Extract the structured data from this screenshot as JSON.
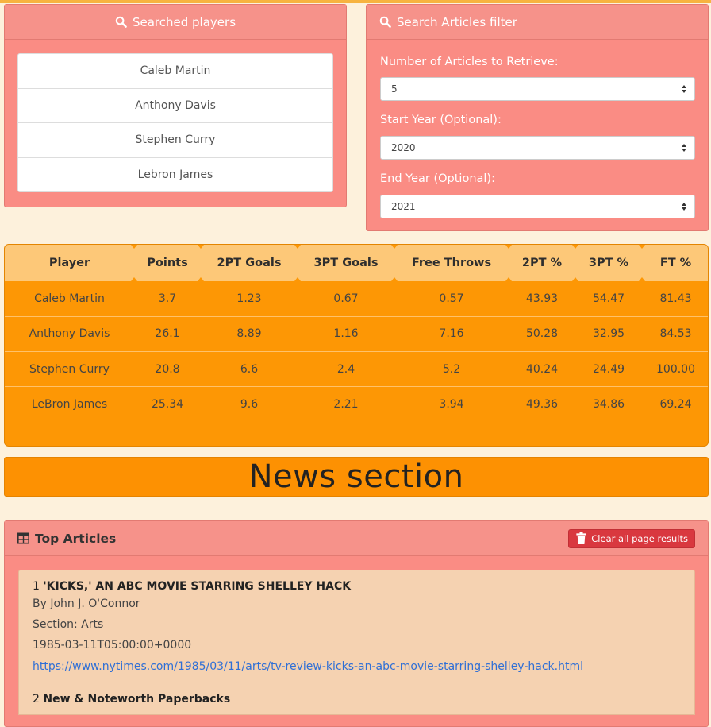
{
  "players_panel": {
    "title": "Searched players",
    "icon": "search-icon",
    "players": [
      "Caleb Martin",
      "Anthony Davis",
      "Stephen Curry",
      "Lebron James"
    ]
  },
  "filter_panel": {
    "title": "Search Articles filter",
    "icon": "search-icon",
    "num_articles_label": "Number of Articles to Retrieve:",
    "num_articles_value": "5",
    "start_year_label": "Start Year (Optional):",
    "start_year_value": "2020",
    "end_year_label": "End Year (Optional):",
    "end_year_value": "2021"
  },
  "stats_table": {
    "headers": [
      "Player",
      "Points",
      "2PT Goals",
      "3PT Goals",
      "Free Throws",
      "2PT %",
      "3PT %",
      "FT %"
    ],
    "rows": [
      [
        "Caleb Martin",
        "3.7",
        "1.23",
        "0.67",
        "0.57",
        "43.93",
        "54.47",
        "81.43"
      ],
      [
        "Anthony Davis",
        "26.1",
        "8.89",
        "1.16",
        "7.16",
        "50.28",
        "32.95",
        "84.53"
      ],
      [
        "Stephen Curry",
        "20.8",
        "6.6",
        "2.4",
        "5.2",
        "40.24",
        "24.49",
        "100.00"
      ],
      [
        "LeBron James",
        "25.34",
        "9.6",
        "2.21",
        "3.94",
        "49.36",
        "34.86",
        "69.24"
      ]
    ]
  },
  "news": {
    "heading": "News section"
  },
  "articles": {
    "title": "Top Articles",
    "icon": "table-icon",
    "clear_button": "Clear all page results",
    "clear_icon": "trash-icon",
    "items": [
      {
        "num": "1",
        "title": "'KICKS,' AN ABC MOVIE STARRING SHELLEY HACK",
        "byline": "By John J. O'Connor",
        "section": "Section: Arts",
        "date": "1985-03-11T05:00:00+0000",
        "url": "https://www.nytimes.com/1985/03/11/arts/tv-review-kicks-an-abc-movie-starring-shelley-hack.html"
      },
      {
        "num": "2",
        "title": "New & Noteworth Paperbacks"
      }
    ]
  },
  "colors": {
    "panel": "#fa8c84",
    "table_body": "#fd9705",
    "table_header": "#fdc878",
    "page_bg": "#fdf1dc",
    "danger": "#d9383f",
    "link": "#2f6fd6"
  }
}
